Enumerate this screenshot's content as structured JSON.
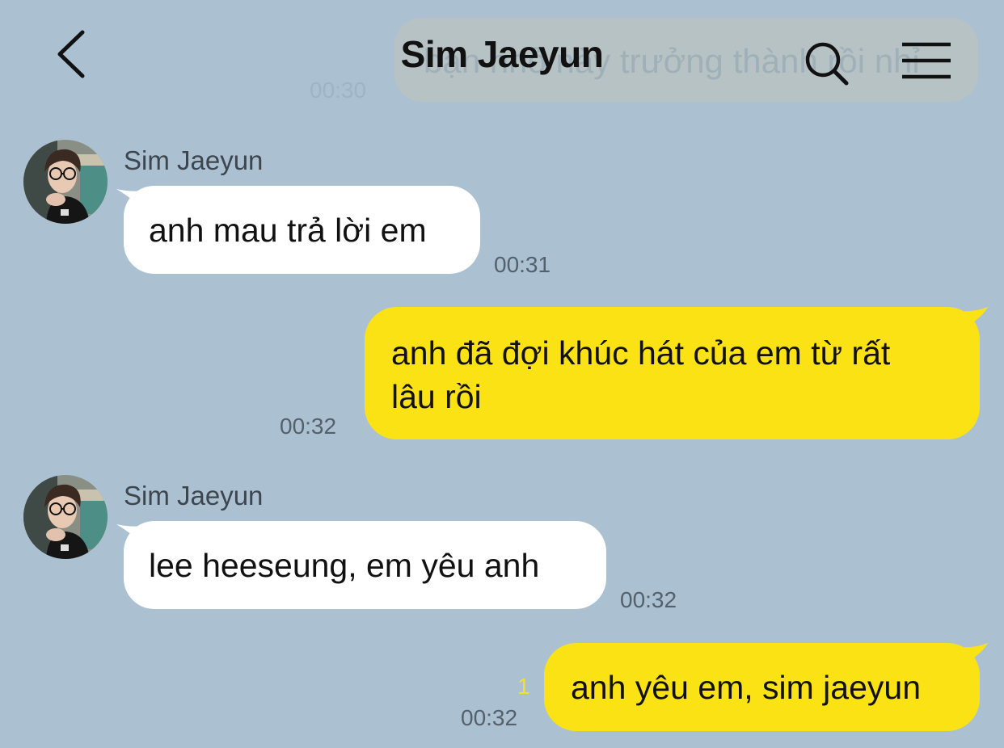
{
  "header": {
    "title": "Sim Jaeyun",
    "back_icon": "chevron-left-icon",
    "search_icon": "search-icon",
    "menu_icon": "menu-icon"
  },
  "previous_message": {
    "text": "bạn nhỏ này trưởng thành rồi nhỉ",
    "time": "00:30"
  },
  "messages": [
    {
      "direction": "incoming",
      "sender": "Sim Jaeyun",
      "text": "anh mau trả lời em",
      "time": "00:31"
    },
    {
      "direction": "outgoing",
      "text_line1": "anh đã đợi khúc hát của em từ rất",
      "text_line2": "lâu rồi",
      "time": "00:32"
    },
    {
      "direction": "incoming",
      "sender": "Sim Jaeyun",
      "text": "lee heeseung, em yêu anh",
      "time": "00:32"
    },
    {
      "direction": "outgoing",
      "text": "anh yêu em, sim jaeyun",
      "time": "00:32",
      "unread": "1"
    }
  ],
  "colors": {
    "background": "#abc1d1",
    "outgoing_bubble": "#fbe214",
    "incoming_bubble": "#ffffff",
    "unread_count": "#f3e02a"
  }
}
